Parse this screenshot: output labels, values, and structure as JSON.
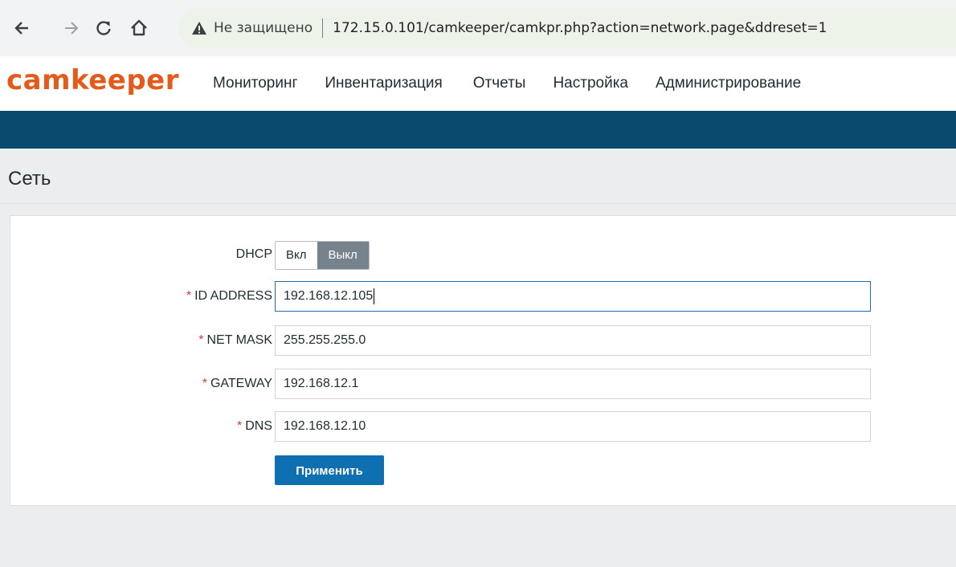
{
  "browser": {
    "insecure_label": "Не защищено",
    "url": "172.15.0.101/camkeeper/camkpr.php?action=network.page&ddreset=1"
  },
  "app": {
    "logo": "camkeeper",
    "menu": [
      {
        "label": "Мониторинг"
      },
      {
        "label": "Инвентаризация"
      },
      {
        "label": "Отчеты"
      },
      {
        "label": "Настройка"
      },
      {
        "label": "Администрирование"
      }
    ]
  },
  "page": {
    "title": "Сеть"
  },
  "form": {
    "dhcp": {
      "label": "DHCP",
      "on_label": "Вкл",
      "off_label": "Выкл",
      "selected": "Выкл"
    },
    "ip": {
      "required_mark": "*",
      "label": "ID ADDRESS",
      "value": "192.168.12.105"
    },
    "mask": {
      "required_mark": "*",
      "label": "NET MASK",
      "value": "255.255.255.0"
    },
    "gateway": {
      "required_mark": "*",
      "label": "GATEWAY",
      "value": "192.168.12.1"
    },
    "dns": {
      "required_mark": "*",
      "label": "DNS",
      "value": "192.168.12.10"
    },
    "apply_label": "Применить"
  },
  "colors": {
    "logo": "#e45a1b",
    "header_band": "#0b4a6f",
    "primary_button": "#0e6fb1",
    "required": "#d13b3b"
  }
}
